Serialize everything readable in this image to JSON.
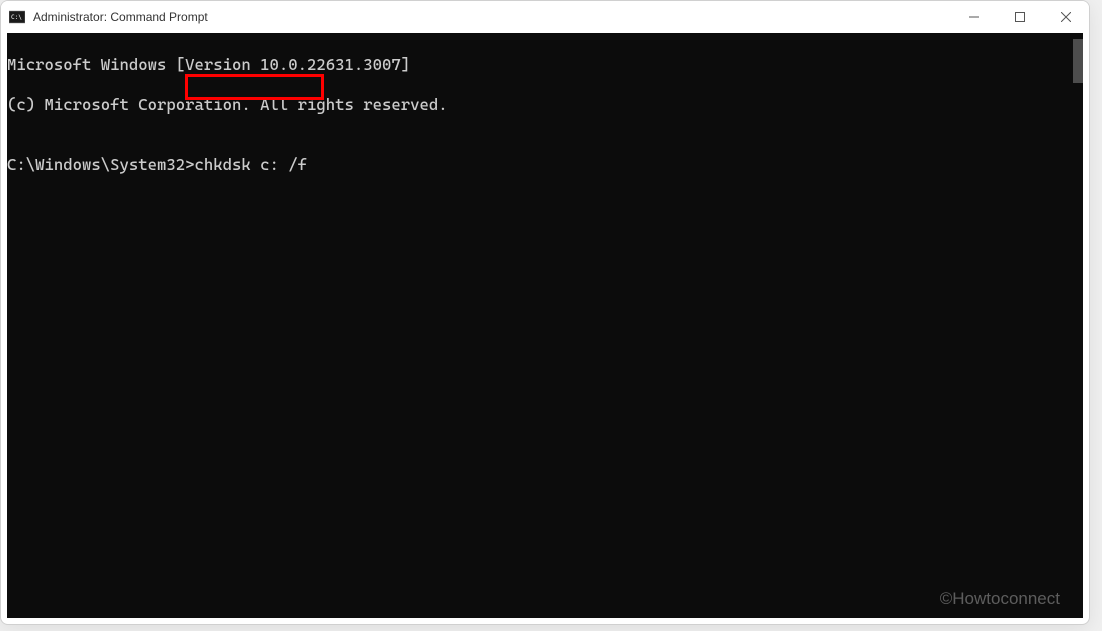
{
  "window": {
    "title": "Administrator: Command Prompt"
  },
  "terminal": {
    "line1": "Microsoft Windows [Version 10.0.22631.3007]",
    "line2": "(c) Microsoft Corporation. All rights reserved.",
    "blank": "",
    "prompt": "C:\\Windows\\System32>",
    "command": "chkdsk c: /f"
  },
  "watermark": "©Howtoconnect"
}
